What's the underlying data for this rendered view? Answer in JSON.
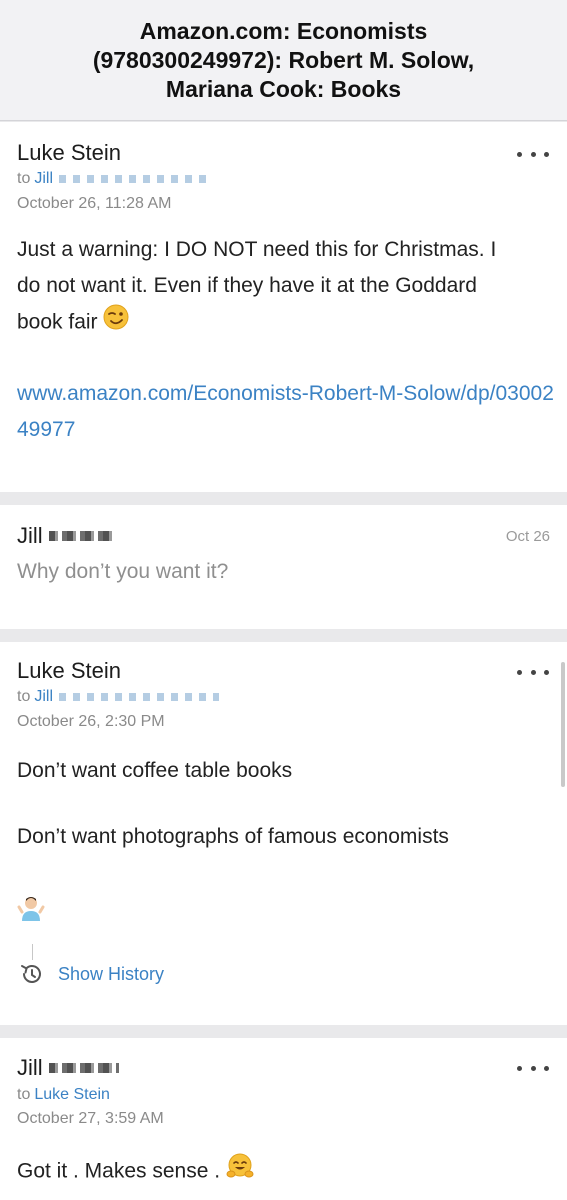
{
  "header": {
    "title": "Amazon.com: Economists (9780300249972): Robert M. Solow, Mariana Cook: Books"
  },
  "messages": [
    {
      "sender": "Luke Stein",
      "to_prefix": "to",
      "recipient": "Jill",
      "date": "October 26, 11:28 AM",
      "body_lines": [
        "Just a warning: I DO NOT need this for Christmas. I",
        "do not want it. Even if they have it at the Goddard",
        "book fair"
      ],
      "link": "www.amazon.com/Economists-Robert-M-Solow/dp/0300249977",
      "emoji": "winking-face"
    },
    {
      "sender": "Jill",
      "date_short": "Oct 26",
      "preview": "Why don’t you want it?"
    },
    {
      "sender": "Luke Stein",
      "to_prefix": "to",
      "recipient": "Jill",
      "date": "October 26, 2:30 PM",
      "para1": "Don’t want coffee table books",
      "para2": "Don’t want photographs of famous economists",
      "emoji": "person-shrugging",
      "show_history": "Show History"
    },
    {
      "sender": "Jill",
      "to_prefix": "to",
      "recipient": "Luke Stein",
      "date": "October 27, 3:59 AM",
      "body": "Got it .  Makes sense .",
      "emoji": "hugging-face"
    }
  ],
  "colors": {
    "link": "#3b82c4",
    "muted": "#8a8a8a",
    "separator": "#e9e9eb"
  }
}
